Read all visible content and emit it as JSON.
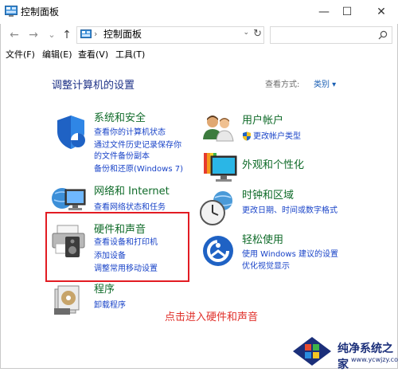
{
  "window": {
    "title": "控制面板",
    "controls": {
      "minimize": "—",
      "maximize": "☐",
      "close": "✕"
    }
  },
  "nav": {
    "back": "←",
    "forward": "→",
    "recent": "⌄",
    "up": "↑",
    "address_sep": "›",
    "address_text": "控制面板",
    "address_dropdown": "⌄",
    "refresh": "↻",
    "search_placeholder": ""
  },
  "menu": [
    "文件(F)",
    "编辑(E)",
    "查看(V)",
    "工具(T)"
  ],
  "main": {
    "heading": "调整计算机的设置",
    "view_by_label": "查看方式:",
    "view_by_value": "类别 ▾"
  },
  "categories": {
    "system": {
      "title": "系统和安全",
      "links": [
        "查看你的计算机状态",
        "通过文件历史记录保存你",
        "的文件备份副本",
        "备份和还原(Windows 7)"
      ]
    },
    "network": {
      "title": "网络和 Internet",
      "links": [
        "查看网络状态和任务"
      ]
    },
    "hardware": {
      "title": "硬件和声音",
      "links": [
        "查看设备和打印机",
        "添加设备",
        "调整常用移动设置"
      ]
    },
    "programs": {
      "title": "程序",
      "links": [
        "卸载程序"
      ]
    },
    "accounts": {
      "title": "用户帐户",
      "links": [
        "更改帐户类型"
      ]
    },
    "appearance": {
      "title": "外观和个性化",
      "links": []
    },
    "clock": {
      "title": "时钟和区域",
      "links": [
        "更改日期、时间或数字格式"
      ]
    },
    "ease": {
      "title": "轻松使用",
      "links": [
        "使用 Windows 建议的设置",
        "优化视觉显示"
      ]
    }
  },
  "annotation": "点击进入硬件和声音",
  "watermark": {
    "title": "纯净系统之家",
    "url": "www.ycwjzy.com"
  },
  "colors": {
    "category_title": "#0f6b29",
    "link": "#1a44c8",
    "heading": "#1e3287",
    "highlight_box": "#e21c23",
    "annotation": "#e0302a"
  }
}
